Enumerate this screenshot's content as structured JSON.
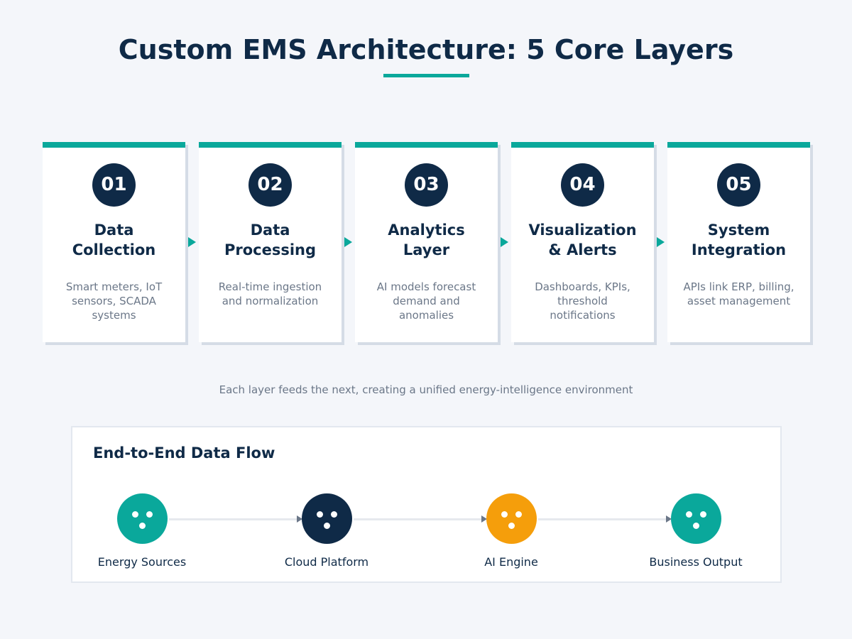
{
  "title": "Custom EMS Architecture: 5 Core Layers",
  "subtitle": "Each layer feeds the next, creating a unified energy-intelligence environment",
  "colors": {
    "teal": "#0aa89b",
    "navy": "#0f2a47",
    "amber": "#f59e0b",
    "muted": "#6b7788"
  },
  "layers": [
    {
      "number": "01",
      "title": "Data\nCollection",
      "description": "Smart meters, IoT\nsensors, SCADA\nsystems"
    },
    {
      "number": "02",
      "title": "Data\nProcessing",
      "description": "Real-time ingestion\nand normalization"
    },
    {
      "number": "03",
      "title": "Analytics\nLayer",
      "description": "AI models forecast\ndemand and\nanomalies"
    },
    {
      "number": "04",
      "title": "Visualization\n& Alerts",
      "description": "Dashboards, KPIs,\nthreshold\nnotifications"
    },
    {
      "number": "05",
      "title": "System\nIntegration",
      "description": "APIs link ERP, billing,\nasset management"
    }
  ],
  "flow": {
    "title": "End-to-End Data Flow",
    "nodes": [
      {
        "label": "Energy Sources",
        "color": "#0aa89b",
        "icon": "node-icon"
      },
      {
        "label": "Cloud Platform",
        "color": "#0f2a47",
        "icon": "node-icon"
      },
      {
        "label": "AI Engine",
        "color": "#f59e0b",
        "icon": "node-icon"
      },
      {
        "label": "Business Output",
        "color": "#0aa89b",
        "icon": "node-icon"
      }
    ]
  }
}
